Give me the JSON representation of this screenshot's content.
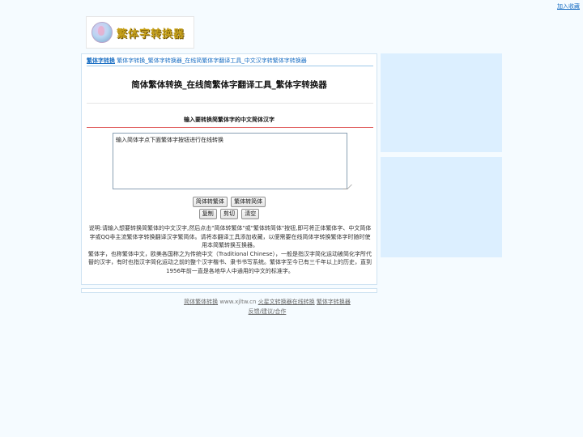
{
  "top_links": {
    "bookmark": "加入收藏"
  },
  "logo": {
    "text": "繁体字转换器"
  },
  "breadcrumb": {
    "home": "繁体字转换",
    "rest": "繁体字转换_繁体字转换器_在线简繁体字翻译工具_中文汉字转繁体字转换器"
  },
  "page": {
    "title": "简体繁体转换_在线简繁体字翻译工具_繁体字转换器",
    "subtitle": "输入要转换简繁体字的中文简体汉字"
  },
  "editor": {
    "value": "输入简体字点下面繁体字按钮进行在线转换"
  },
  "buttons": {
    "to_traditional": "简体转繁体",
    "to_simplified": "繁体转简体",
    "copy": "复制",
    "cut": "剪切",
    "clear": "清空"
  },
  "description": {
    "p1": "说明:请输入想要转换简繁体的中文汉字,然后点击\"简体转繁体\"或\"繁体转简体\"按钮,即可将正体繁体字、中文简体字或QQ非主流繁体字转换翻译汉字繁简体。请将本翻译工具添加收藏，以便需要在线简体字转换繁体字时随时使用本简繁转换互换器。",
    "p2": "繁体字，也称繁体中文，欧美各国称之为传统中文（Traditional Chinese），一般是指汉字简化运动被简化字所代替的汉字，有时也指汉字简化运动之前的整个汉字楷书、隶书书写系统。繁体字至今已有三千年以上的历史，直到1956年前一直是各地华人中通用的中文的标准字。"
  },
  "footer": {
    "link1": "简体繁体转换",
    "site": "www.xjltw.cn",
    "link2": "火星文转换器在线转换",
    "link3": "繁体字转换器",
    "link4": "反馈/建议/合作"
  },
  "colors": {
    "page_bg": "#f5fbff",
    "link": "#1a6fc4",
    "side_panel": "#dcefff",
    "accent_line": "#e06060"
  }
}
